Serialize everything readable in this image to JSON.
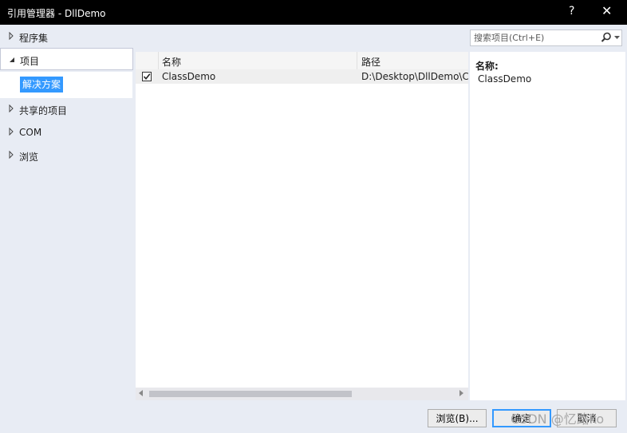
{
  "window": {
    "title": "引用管理器 - DllDemo",
    "help_label": "?",
    "close_label": "✕"
  },
  "sidebar": {
    "items": [
      {
        "label": "程序集",
        "expanded": false
      },
      {
        "label": "项目",
        "expanded": true,
        "children": [
          {
            "label": "解决方案",
            "selected": true
          }
        ]
      },
      {
        "label": "共享的项目",
        "expanded": false
      },
      {
        "label": "COM",
        "expanded": false
      },
      {
        "label": "浏览",
        "expanded": false
      }
    ]
  },
  "search": {
    "placeholder": "搜索项目(Ctrl+E)",
    "icon": "magnifier-icon"
  },
  "list": {
    "columns": [
      "名称",
      "路径"
    ],
    "rows": [
      {
        "checked": true,
        "name": "ClassDemo",
        "path": "D:\\Desktop\\DllDemo\\C"
      }
    ]
  },
  "details": {
    "name_label": "名称:",
    "name_value": "ClassDemo"
  },
  "footer": {
    "browse_label": "浏览(B)...",
    "ok_label": "确定",
    "cancel_label": "取消"
  },
  "watermark": "CSDN @忆路ko",
  "colors": {
    "titlebar": "#000000",
    "selection": "#3399ff",
    "background": "#e8ecf4"
  }
}
